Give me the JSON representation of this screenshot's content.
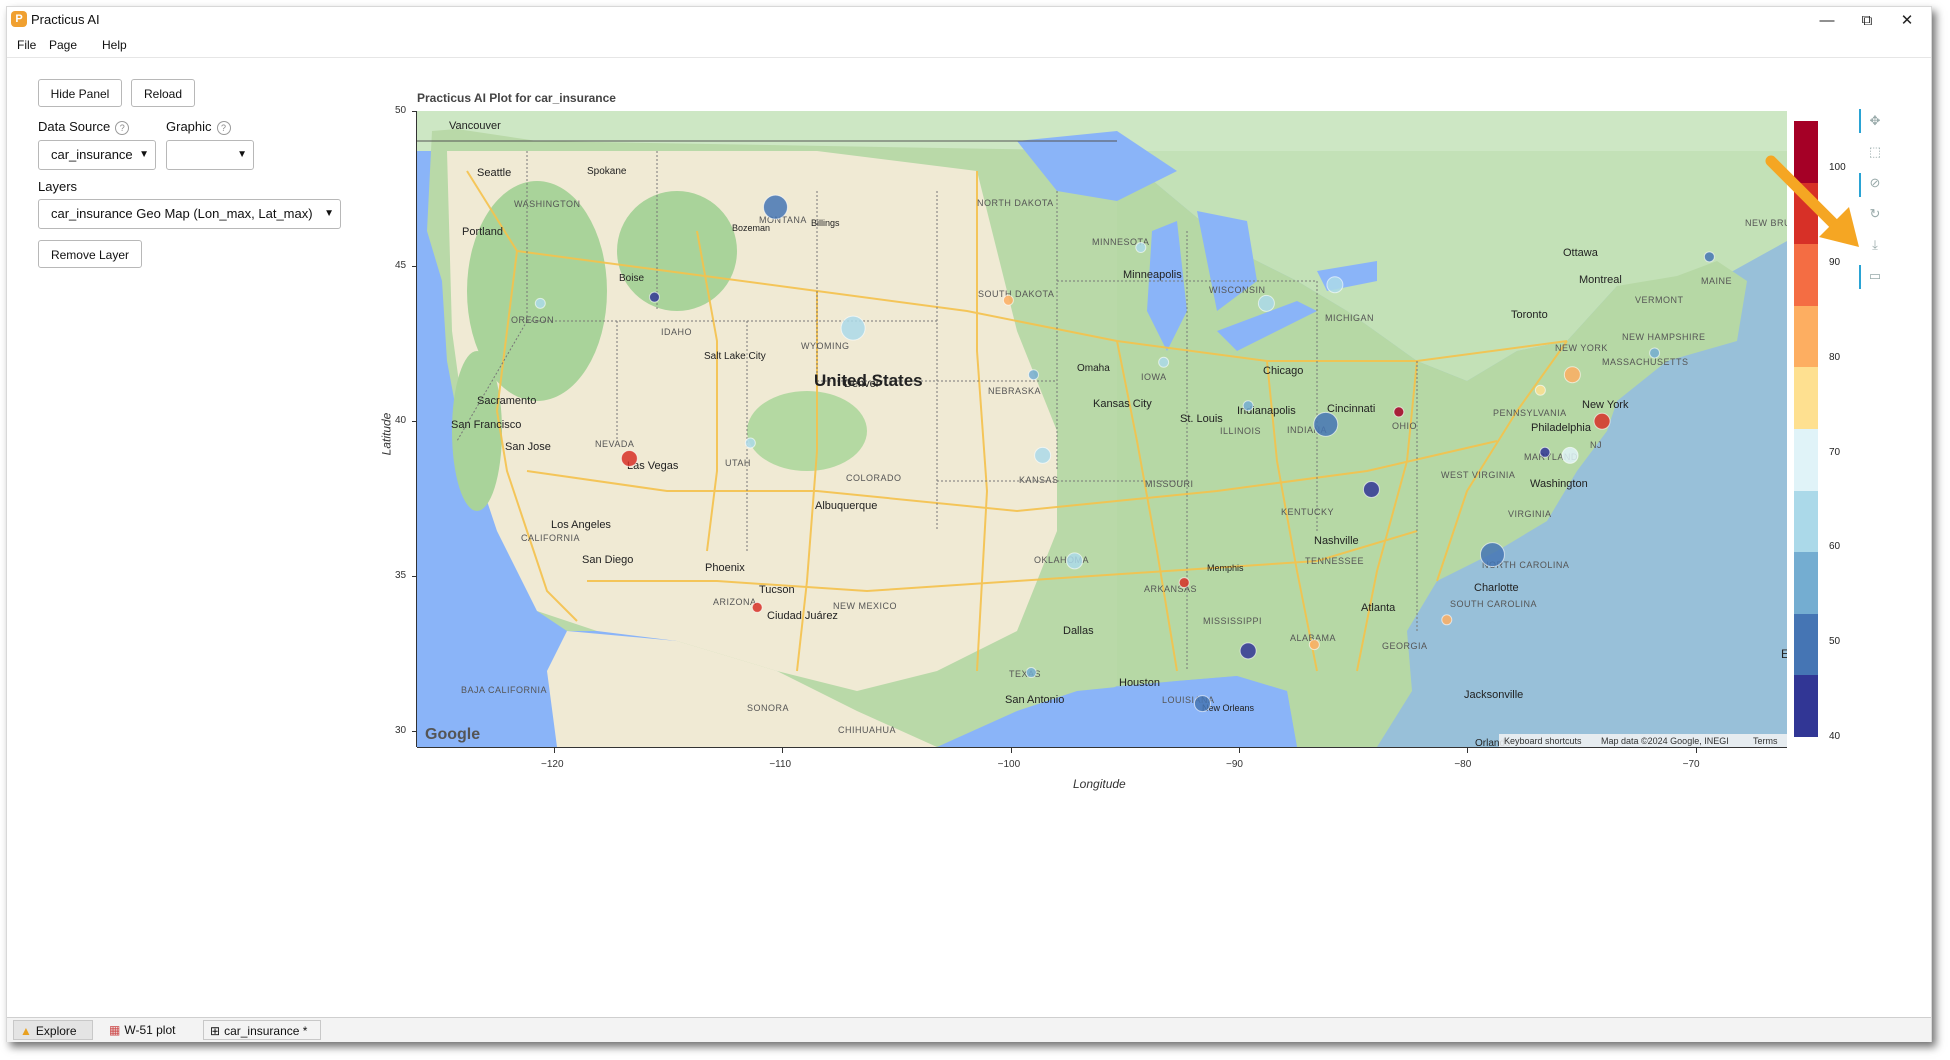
{
  "app": {
    "title": "Practicus AI",
    "logo_glyph": "P"
  },
  "window_controls": {
    "minimize": "—",
    "maximize": "⧉",
    "close": "✕"
  },
  "menu": {
    "items": [
      "File",
      "Page",
      "Help"
    ]
  },
  "panel": {
    "hide_panel": "Hide Panel",
    "reload": "Reload",
    "data_source_label": "Data Source",
    "data_source_value": "car_insurance",
    "graphic_label": "Graphic",
    "graphic_value": "",
    "layers_label": "Layers",
    "layers_value": "car_insurance Geo Map (Lon_max, Lat_max)",
    "remove_layer": "Remove Layer",
    "help_glyph": "?"
  },
  "plot": {
    "title": "Practicus AI Plot for car_insurance",
    "xlabel": "Longitude",
    "ylabel": "Latitude",
    "x_ticks": [
      "−120",
      "−110",
      "−100",
      "−90",
      "−80",
      "−70"
    ],
    "y_ticks": [
      "50",
      "45",
      "40",
      "35",
      "30"
    ],
    "map_attribution": [
      "Keyboard shortcuts",
      "Map data ©2024 Google, INEGI",
      "Terms"
    ],
    "map_logo": "Google",
    "colorbar": {
      "ticks": [
        "100",
        "90",
        "80",
        "70",
        "60",
        "50",
        "40"
      ],
      "colors": [
        "#a50026",
        "#d73027",
        "#f46d43",
        "#fdae61",
        "#fee090",
        "#e0f3f8",
        "#abd9e9",
        "#74add1",
        "#4575b4",
        "#313695"
      ]
    }
  },
  "map_labels": {
    "country": "United States",
    "cities": [
      "Vancouver",
      "Seattle",
      "Spokane",
      "Portland",
      "Boise",
      "Billings",
      "Bozeman",
      "Salt Lake City",
      "Denver",
      "Sacramento",
      "San Francisco",
      "San Jose",
      "Las Vegas",
      "Los Angeles",
      "San Diego",
      "Phoenix",
      "Tucson",
      "Albuquerque",
      "Ciudad Juárez",
      "Minneapolis",
      "Omaha",
      "Kansas City",
      "St. Louis",
      "Chicago",
      "Indianapolis",
      "Cincinnati",
      "Memphis",
      "Nashville",
      "Dallas",
      "Houston",
      "San Antonio",
      "New Orleans",
      "Atlanta",
      "Charlotte",
      "Jacksonville",
      "Orlando",
      "Washington",
      "Philadelphia",
      "New York",
      "Toronto",
      "Ottawa",
      "Montreal"
    ],
    "states": [
      "WASHINGTON",
      "OREGON",
      "IDAHO",
      "MONTANA",
      "WYOMING",
      "NEVADA",
      "UTAH",
      "CALIFORNIA",
      "ARIZONA",
      "COLORADO",
      "NEW MEXICO",
      "NORTH DAKOTA",
      "SOUTH DAKOTA",
      "NEBRASKA",
      "KANSAS",
      "OKLAHOMA",
      "TEXAS",
      "MINNESOTA",
      "IOWA",
      "MISSOURI",
      "ARKANSAS",
      "LOUISIANA",
      "WISCONSIN",
      "ILLINOIS",
      "MICHIGAN",
      "INDIANA",
      "OHIO",
      "KENTUCKY",
      "TENNESSEE",
      "MISSISSIPPI",
      "ALABAMA",
      "GEORGIA",
      "SOUTH CAROLINA",
      "NORTH CAROLINA",
      "VIRGINIA",
      "WEST VIRGINIA",
      "PENNSYLVANIA",
      "NEW YORK",
      "MARYLAND",
      "NJ",
      "VERMONT",
      "NEW HAMPSHIRE",
      "MASSACHUSETTS",
      "MAINE",
      "BAJA CALIFORNIA",
      "SONORA",
      "CHIHUAHUA",
      "NEW BRUNSW",
      "E"
    ]
  },
  "chart_data": {
    "type": "scatter",
    "title": "Practicus AI Plot for car_insurance",
    "xlabel": "Longitude",
    "ylabel": "Latitude",
    "xlim": [
      -126,
      -66
    ],
    "ylim": [
      29.5,
      50
    ],
    "color_range": [
      40,
      105
    ],
    "points": [
      {
        "lon": -110.3,
        "lat": 46.9,
        "value": 50,
        "size": 3
      },
      {
        "lon": -106.9,
        "lat": 43.0,
        "value": 60,
        "size": 3
      },
      {
        "lon": -115.6,
        "lat": 44.0,
        "value": 45,
        "size": 1
      },
      {
        "lon": -120.6,
        "lat": 43.8,
        "value": 60,
        "size": 1
      },
      {
        "lon": -100.1,
        "lat": 43.9,
        "value": 85,
        "size": 1
      },
      {
        "lon": -99.0,
        "lat": 41.5,
        "value": 55,
        "size": 1
      },
      {
        "lon": -98.6,
        "lat": 38.9,
        "value": 65,
        "size": 2
      },
      {
        "lon": -97.2,
        "lat": 35.5,
        "value": 65,
        "size": 2
      },
      {
        "lon": -99.1,
        "lat": 31.9,
        "value": 55,
        "size": 1
      },
      {
        "lon": -116.7,
        "lat": 38.8,
        "value": 92,
        "size": 2
      },
      {
        "lon": -111.1,
        "lat": 34.0,
        "value": 92,
        "size": 1
      },
      {
        "lon": -111.4,
        "lat": 39.3,
        "value": 60,
        "size": 1
      },
      {
        "lon": -92.4,
        "lat": 34.8,
        "value": 92,
        "size": 1
      },
      {
        "lon": -91.6,
        "lat": 30.9,
        "value": 50,
        "size": 2
      },
      {
        "lon": -89.6,
        "lat": 32.6,
        "value": 45,
        "size": 2
      },
      {
        "lon": -86.7,
        "lat": 32.8,
        "value": 85,
        "size": 1
      },
      {
        "lon": -88.8,
        "lat": 43.8,
        "value": 60,
        "size": 2
      },
      {
        "lon": -89.6,
        "lat": 40.5,
        "value": 55,
        "size": 1
      },
      {
        "lon": -86.2,
        "lat": 39.9,
        "value": 50,
        "size": 3
      },
      {
        "lon": -85.8,
        "lat": 44.4,
        "value": 60,
        "size": 2
      },
      {
        "lon": -83.0,
        "lat": 40.3,
        "value": 100,
        "size": 1
      },
      {
        "lon": -84.2,
        "lat": 37.8,
        "value": 40,
        "size": 2
      },
      {
        "lon": -78.9,
        "lat": 35.7,
        "value": 50,
        "size": 3
      },
      {
        "lon": -80.9,
        "lat": 33.6,
        "value": 85,
        "size": 1
      },
      {
        "lon": -74.1,
        "lat": 40.0,
        "value": 92,
        "size": 2
      },
      {
        "lon": -76.6,
        "lat": 39.0,
        "value": 45,
        "size": 1
      },
      {
        "lon": -75.5,
        "lat": 38.9,
        "value": 70,
        "size": 2
      },
      {
        "lon": -75.4,
        "lat": 41.5,
        "value": 85,
        "size": 2
      },
      {
        "lon": -71.8,
        "lat": 42.2,
        "value": 55,
        "size": 1
      },
      {
        "lon": -69.4,
        "lat": 45.3,
        "value": 50,
        "size": 1
      },
      {
        "lon": -93.3,
        "lat": 41.9,
        "value": 60,
        "size": 1
      },
      {
        "lon": -94.3,
        "lat": 45.6,
        "value": 60,
        "size": 1
      },
      {
        "lon": -76.8,
        "lat": 41.0,
        "value": 75,
        "size": 1
      }
    ]
  },
  "toolbar": {
    "icons": [
      "pan-icon",
      "box-zoom-icon",
      "wheel-zoom-icon",
      "reset-icon",
      "save-icon",
      "hover-icon"
    ]
  },
  "tabs": [
    {
      "label": "Explore",
      "icon": "explore-icon"
    },
    {
      "label": "W-51 plot",
      "icon": "plot-icon"
    },
    {
      "label": "car_insurance *",
      "icon": "table-icon"
    }
  ]
}
